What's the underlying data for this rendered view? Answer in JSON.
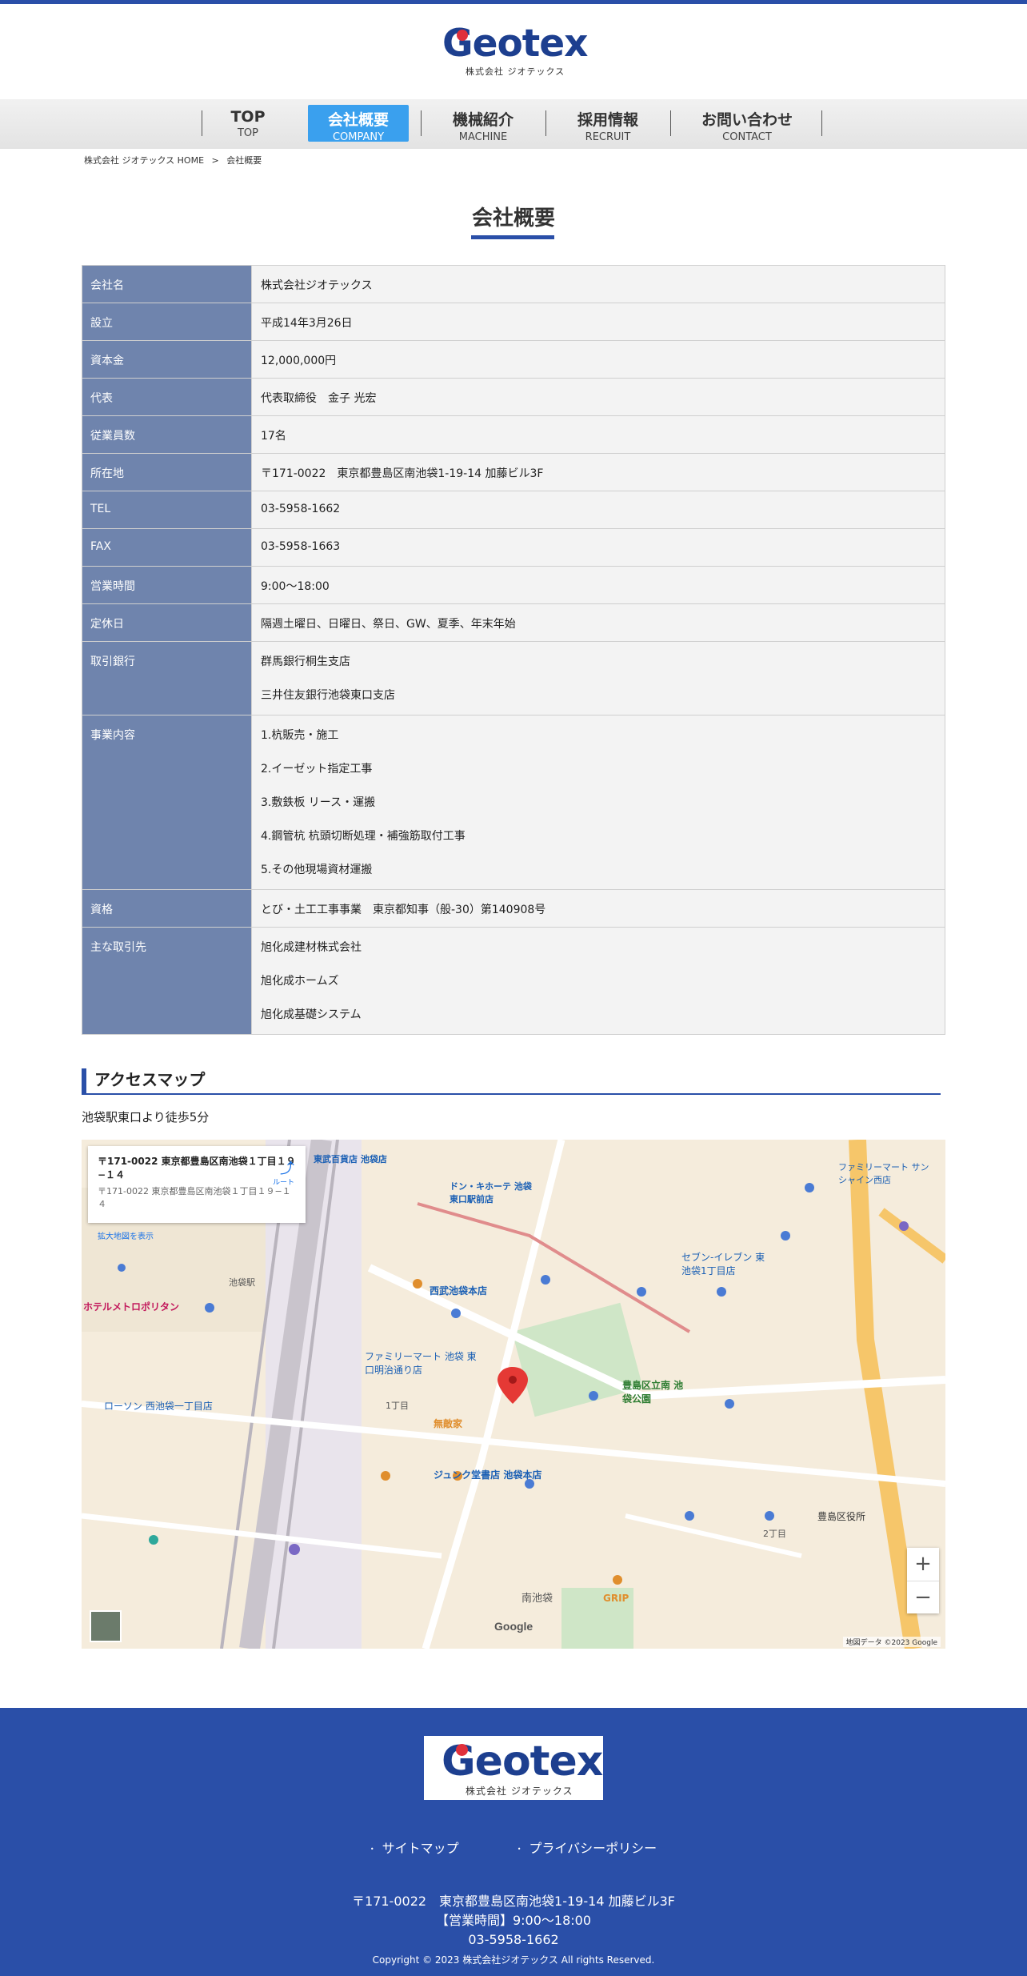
{
  "logo": {
    "word": "Geotex",
    "sub": "株式会社 ジオテックス"
  },
  "nav": [
    {
      "ja": "TOP",
      "en": "TOP"
    },
    {
      "ja": "会社概要",
      "en": "COMPANY"
    },
    {
      "ja": "機械紹介",
      "en": "MACHINE"
    },
    {
      "ja": "採用情報",
      "en": "RECRUIT"
    },
    {
      "ja": "お問い合わせ",
      "en": "CONTACT"
    }
  ],
  "breadcrumb": {
    "home": "株式会社 ジオテックス HOME",
    "sep": ">",
    "current": "会社概要"
  },
  "page_title": "会社概要",
  "company": {
    "rows": [
      {
        "label": "会社名",
        "value": "株式会社ジオテックス"
      },
      {
        "label": "設立",
        "value": "平成14年3月26日"
      },
      {
        "label": "資本金",
        "value": "12,000,000円"
      },
      {
        "label": "代表",
        "value": "代表取締役　金子 光宏"
      },
      {
        "label": "従業員数",
        "value": "17名"
      },
      {
        "label": "所在地",
        "value": "〒171-0022　東京都豊島区南池袋1-19-14 加藤ビル3F"
      },
      {
        "label": "TEL",
        "value": "03-5958-1662"
      },
      {
        "label": "FAX",
        "value": "03-5958-1663"
      },
      {
        "label": "営業時間",
        "value": "9:00〜18:00"
      },
      {
        "label": "定休日",
        "value": "隔週土曜日、日曜日、祭日、GW、夏季、年末年始"
      }
    ],
    "banks_label": "取引銀行",
    "banks": [
      "群馬銀行桐生支店",
      "三井住友銀行池袋東口支店"
    ],
    "business_label": "事業内容",
    "business": [
      "1.杭販売・施工",
      "2.イーゼット指定工事",
      "3.敷鉄板 リース・運搬",
      "4.鋼管杭 杭頭切断処理・補強筋取付工事",
      "5.その他現場資材運搬"
    ],
    "license_label": "資格",
    "license": "とび・土工工事事業　東京都知事（般-30）第140908号",
    "clients_label": "主な取引先",
    "clients": [
      "旭化成建材株式会社",
      "旭化成ホームズ",
      "旭化成基礎システム"
    ]
  },
  "access": {
    "heading": "アクセスマップ",
    "note": "池袋駅東口より徒歩5分",
    "map": {
      "card_address": "〒171-0022 東京都豊島区南池袋１丁目１９−１４",
      "card_address2": "〒171-0022 東京都豊島区南池袋１丁目１９−１４",
      "card_larger": "拡大地図を表示",
      "card_directions": "ルート",
      "labels": {
        "tobu": "東武百貨店 池袋店",
        "donki": "ドン・キホーテ 池袋東口駅前店",
        "seibu": "西武池袋本店",
        "ikebukuro_park": "豊島区立南 池袋公園",
        "junkudo": "ジュンク堂書店 池袋本店",
        "lawson": "ローソン 西池袋一丁目店",
        "famima1": "ファミリーマート 池袋 東口明治通り店",
        "famima2": "ファミリーマート サンシャイン西店",
        "seven": "セブン-イレブン 東池袋1丁目店",
        "toshima": "豊島区役所",
        "metropolitan": "ホテルメトロポリタン",
        "minamiike": "南池袋",
        "chome1": "1丁目",
        "chome2": "2丁目",
        "grip": "GRIP",
        "muteki": "無敵家",
        "ekimae": "池袋駅"
      },
      "google": "Google",
      "copyright": "地図データ ©2023 Google",
      "zoom_in": "+",
      "zoom_out": "−"
    }
  },
  "footer": {
    "links": [
      "サイトマップ",
      "プライバシーポリシー"
    ],
    "address": "〒171-0022　東京都豊島区南池袋1-19-14 加藤ビル3F",
    "hours": "【営業時間】9:00〜18:00",
    "tel": "03-5958-1662",
    "copyright": "Copyright © 2023 株式会社ジオテックス All rights Reserved."
  },
  "colors": {
    "brand": "#2a4fa8",
    "nav_active": "#3aa0ee",
    "table_header": "#6f84ad",
    "logo_dot": "#e0303b"
  }
}
